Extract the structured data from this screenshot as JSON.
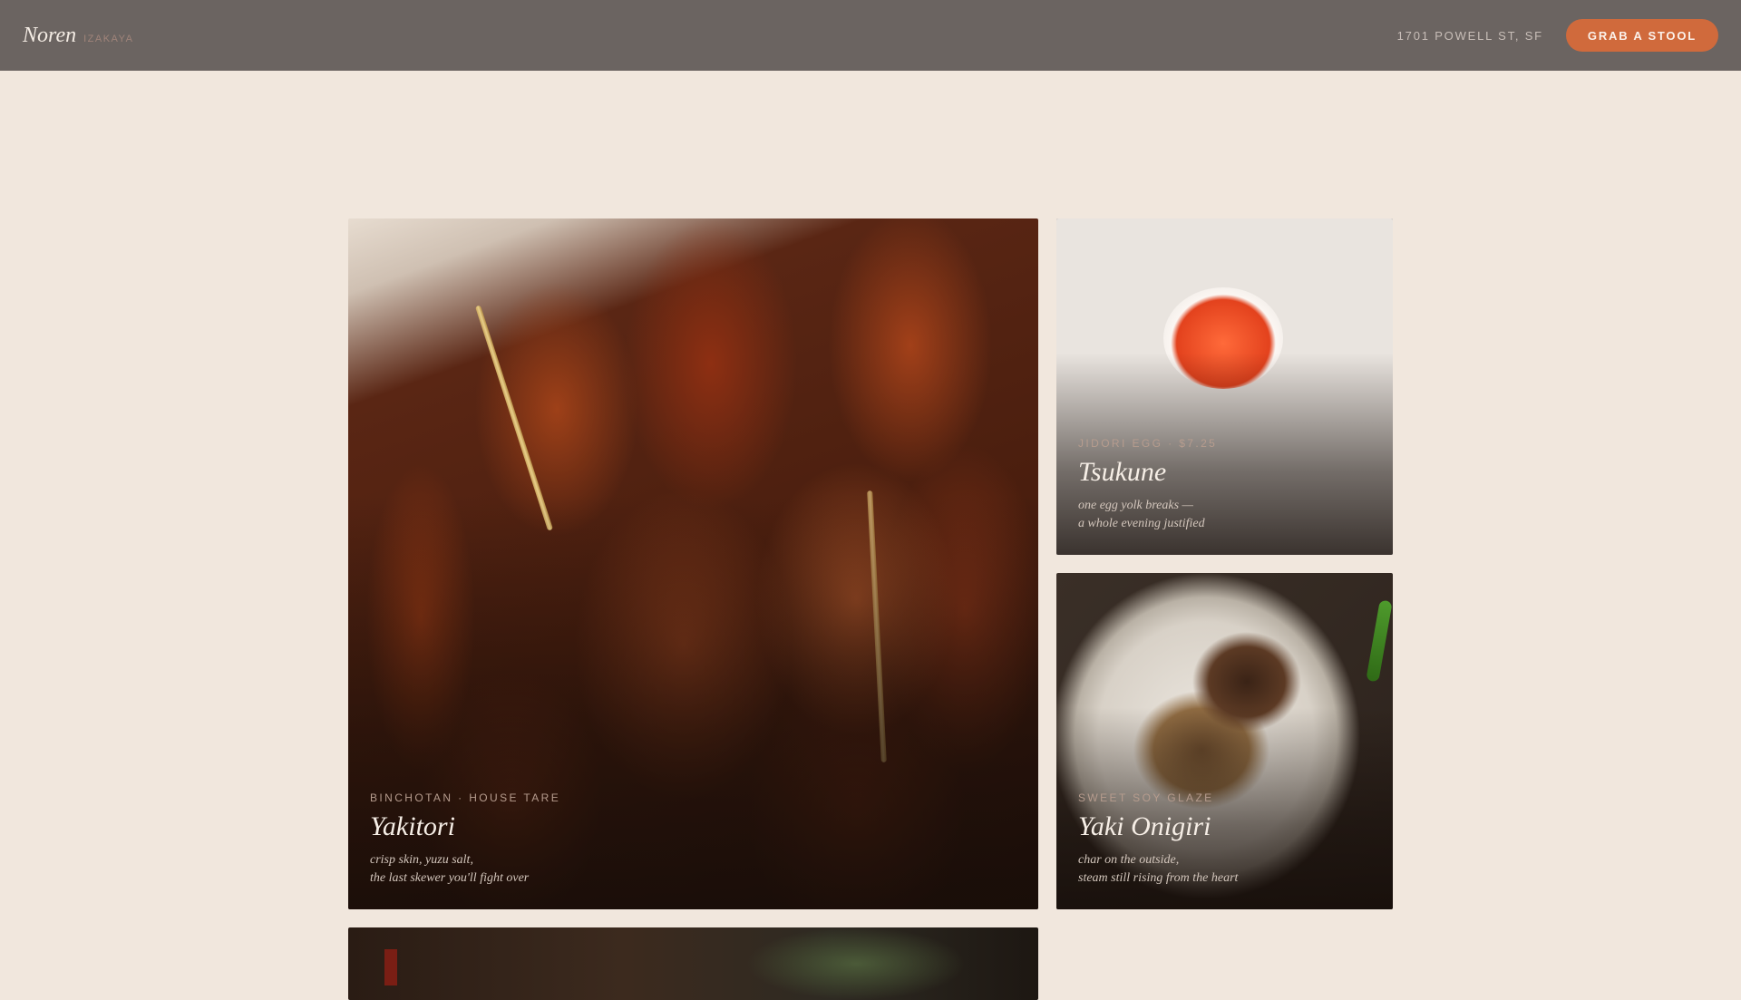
{
  "header": {
    "brand": "Noren",
    "brand_sub": "IZAKAYA",
    "address": "1701 POWELL ST, SF",
    "cta_label": "GRAB A STOOL"
  },
  "colors": {
    "page_bg": "#f1e7dd",
    "header_bg": "#6b6461",
    "accent": "#d06a3c"
  },
  "menu": {
    "items": [
      {
        "kicker": "BINCHOTAN · HOUSE TARE",
        "name": "Yakitori",
        "desc_line1": "crisp skin, yuzu salt,",
        "desc_line2": "the last skewer you'll fight over",
        "photo": "grilled chicken skewers"
      },
      {
        "kicker": "JIDORI EGG · $7.25",
        "name": "Tsukune",
        "desc_line1": "one egg yolk breaks —",
        "desc_line2": "a whole evening justified",
        "photo": "chicken meatballs with chili sauce"
      },
      {
        "kicker": "SWEET SOY GLAZE",
        "name": "Yaki Onigiri",
        "desc_line1": "char on the outside,",
        "desc_line2": "steam still rising from the heart",
        "photo": "charred rice ball on a white plate"
      }
    ]
  }
}
